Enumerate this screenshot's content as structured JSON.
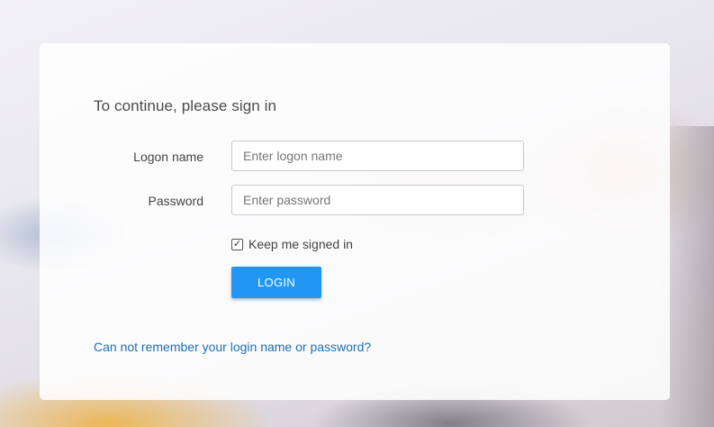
{
  "signin": {
    "heading": "To continue, please sign in",
    "logon_label": "Logon name",
    "logon_placeholder": "Enter logon name",
    "logon_value": "",
    "password_label": "Password",
    "password_placeholder": "Enter password",
    "password_value": "",
    "keep_signed_in_label": "Keep me signed in",
    "keep_signed_in_checked": true,
    "checkbox_glyph": "✓",
    "login_button": "LOGIN",
    "forgot_link": "Can not remember your login name or password?"
  },
  "colors": {
    "accent": "#2196f3",
    "link": "#1f6fb2"
  },
  "icons": {
    "checkbox": "checkbox-checked-icon"
  }
}
